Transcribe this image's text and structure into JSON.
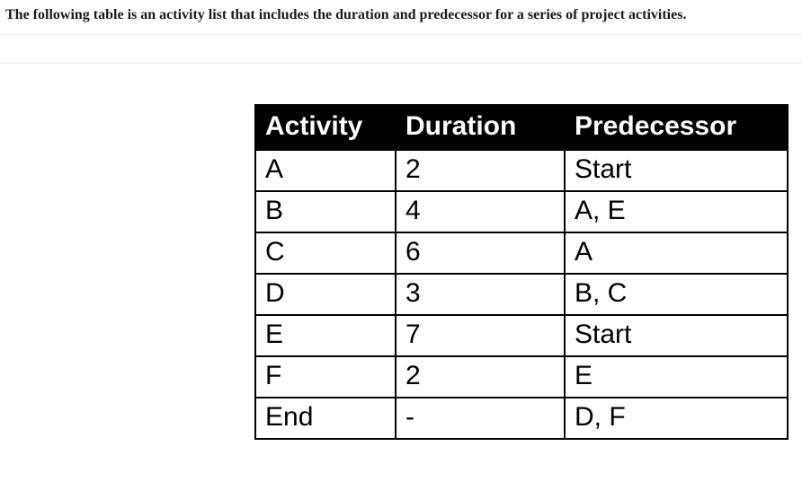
{
  "intro": "The following table is an activity list that includes the duration and predecessor for a series of project activities.",
  "table": {
    "headers": {
      "activity": "Activity",
      "duration": "Duration",
      "predecessor": "Predecessor"
    },
    "rows": [
      {
        "activity": "A",
        "duration": "2",
        "predecessor": "Start"
      },
      {
        "activity": "B",
        "duration": "4",
        "predecessor": "A, E"
      },
      {
        "activity": "C",
        "duration": "6",
        "predecessor": "A"
      },
      {
        "activity": "D",
        "duration": "3",
        "predecessor": "B, C"
      },
      {
        "activity": "E",
        "duration": "7",
        "predecessor": "Start"
      },
      {
        "activity": "F",
        "duration": "2",
        "predecessor": "E"
      },
      {
        "activity": "End",
        "duration": "-",
        "predecessor": "D, F"
      }
    ]
  },
  "chart_data": {
    "type": "table",
    "title": "Project activity list with duration and predecessors",
    "columns": [
      "Activity",
      "Duration",
      "Predecessor"
    ],
    "rows": [
      [
        "A",
        2,
        "Start"
      ],
      [
        "B",
        4,
        "A, E"
      ],
      [
        "C",
        6,
        "A"
      ],
      [
        "D",
        3,
        "B, C"
      ],
      [
        "E",
        7,
        "Start"
      ],
      [
        "F",
        2,
        "E"
      ],
      [
        "End",
        null,
        "D, F"
      ]
    ]
  }
}
